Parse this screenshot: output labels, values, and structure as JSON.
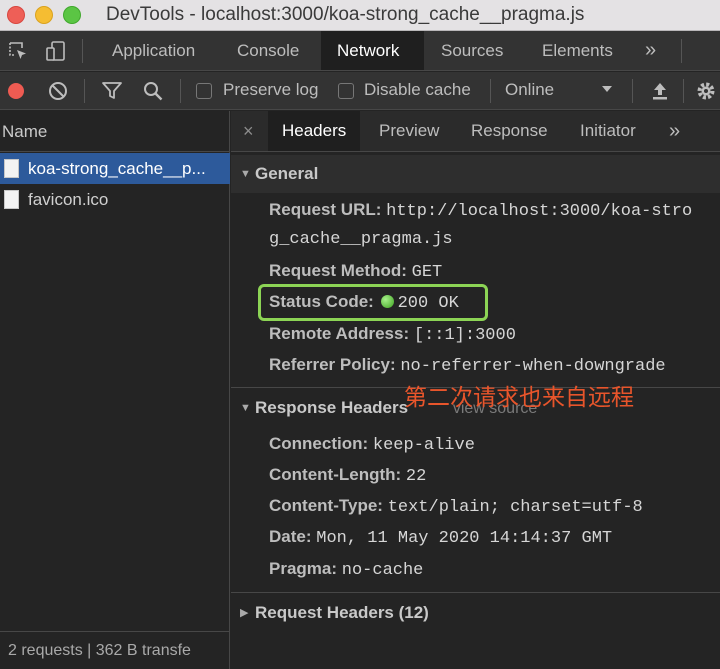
{
  "window": {
    "title": "DevTools - localhost:3000/koa-strong_cache__pragma.js"
  },
  "top_tabs": {
    "items": [
      "Application",
      "Console",
      "Network",
      "Sources",
      "Elements"
    ],
    "active": "Network",
    "overflow": "»"
  },
  "toolbar": {
    "preserve_log": "Preserve log",
    "disable_cache": "Disable cache",
    "throttling": "Online"
  },
  "requests": {
    "header": "Name",
    "items": [
      "koa-strong_cache__p...",
      "favicon.ico"
    ],
    "footer": "2 requests   |   362 B transfe"
  },
  "detail_tabs": {
    "items": [
      "Headers",
      "Preview",
      "Response",
      "Initiator"
    ],
    "active": "Headers",
    "close": "×",
    "overflow": "»"
  },
  "general": {
    "title": "General",
    "request_url_label": "Request URL:",
    "request_url_line1": "http://localhost:3000/koa-stro",
    "request_url_line2": "g_cache__pragma.js",
    "request_method_label": "Request Method:",
    "request_method": "GET",
    "status_code_label": "Status Code:",
    "status_code": "200 OK",
    "remote_address_label": "Remote Address:",
    "remote_address": "[::1]:3000",
    "referrer_policy_label": "Referrer Policy:",
    "referrer_policy": "no-referrer-when-downgrade"
  },
  "annotation": "第二次请求也来自远程",
  "response_headers": {
    "title": "Response Headers",
    "view_source": "view source",
    "items": [
      {
        "key": "Connection:",
        "value": "keep-alive"
      },
      {
        "key": "Content-Length:",
        "value": "22"
      },
      {
        "key": "Content-Type:",
        "value": "text/plain; charset=utf-8"
      },
      {
        "key": "Date:",
        "value": "Mon, 11 May 2020 14:14:37 GMT"
      },
      {
        "key": "Pragma:",
        "value": "no-cache"
      }
    ]
  },
  "request_headers": {
    "title": "Request Headers (12)"
  },
  "colors": {
    "status_ok": "#5bc544",
    "highlight_box": "#8cd455",
    "annotation": "#e8552b",
    "selected_row": "#2d5a9b"
  }
}
